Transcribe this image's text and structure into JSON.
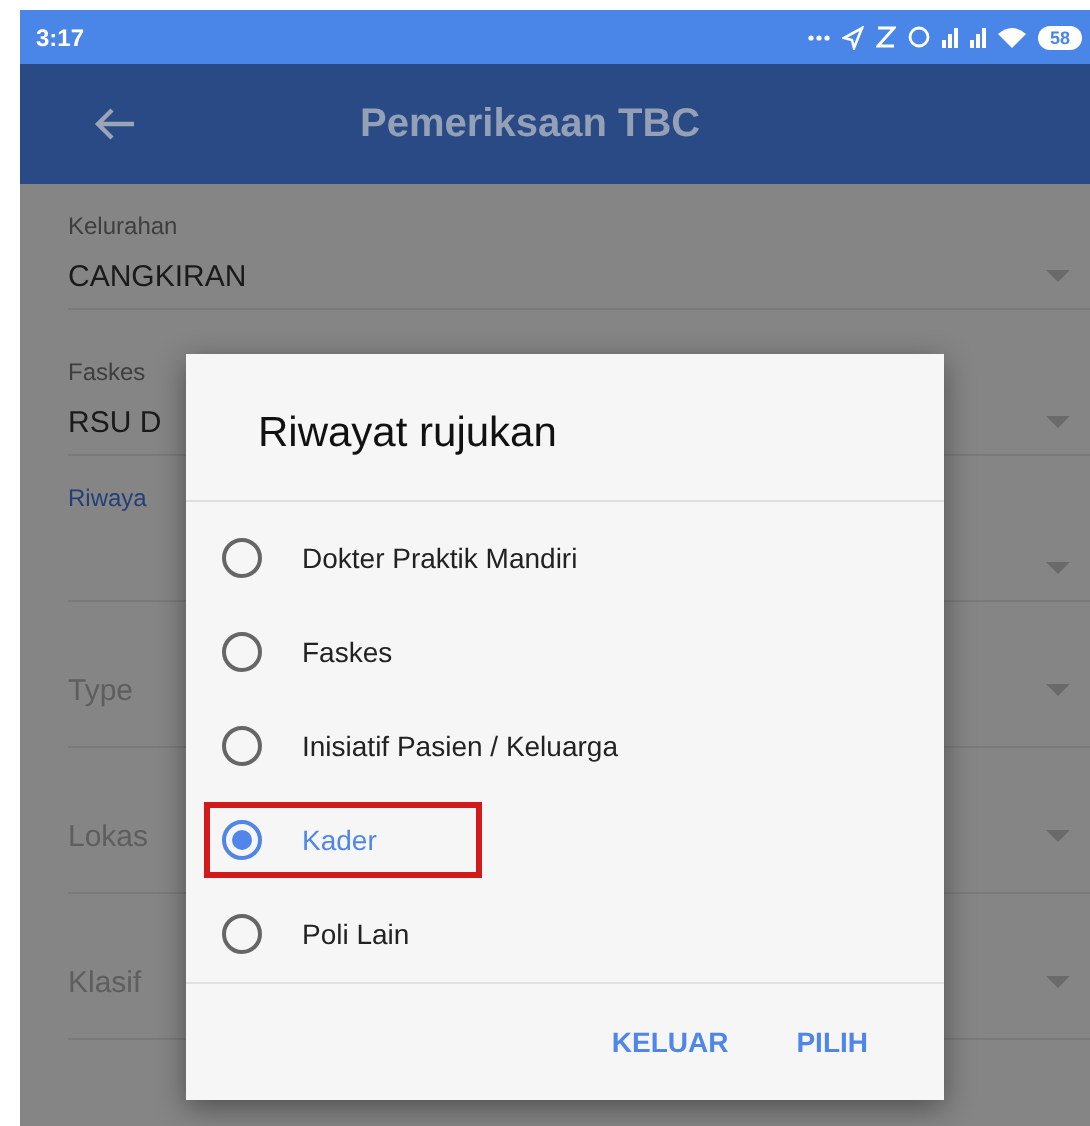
{
  "status_bar": {
    "time": "3:17",
    "battery": "58"
  },
  "app_bar": {
    "title": "Pemeriksaan TBC"
  },
  "fields": [
    {
      "kind": "labeled",
      "label": "Kelurahan",
      "value": "CANGKIRAN"
    },
    {
      "kind": "labeled",
      "label": "Faskes",
      "value": "RSU D"
    },
    {
      "kind": "link",
      "label": "Riwaya"
    },
    {
      "kind": "hint",
      "label": "Type"
    },
    {
      "kind": "hint",
      "label": "Lokas"
    },
    {
      "kind": "hint",
      "label": "Klasif"
    }
  ],
  "dialog": {
    "title": "Riwayat rujukan",
    "options": [
      {
        "label": "Dokter Praktik Mandiri",
        "selected": false,
        "highlighted": false
      },
      {
        "label": "Faskes",
        "selected": false,
        "highlighted": false
      },
      {
        "label": "Inisiatif Pasien / Keluarga",
        "selected": false,
        "highlighted": false
      },
      {
        "label": "Kader",
        "selected": true,
        "highlighted": true
      },
      {
        "label": "Poli Lain",
        "selected": false,
        "highlighted": false
      }
    ],
    "buttons": [
      "KELUAR",
      "PILIH"
    ]
  }
}
